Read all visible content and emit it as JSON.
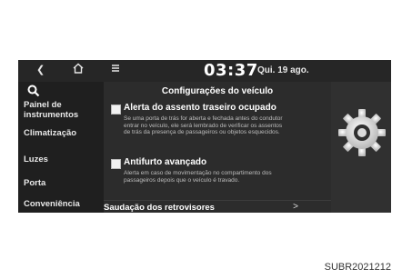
{
  "topbar": {
    "back_icon": "back-arrow-icon",
    "home_icon": "home-icon",
    "menu_icon": "menu-icon",
    "time": "03:37",
    "date": "Qui. 19 ago."
  },
  "sidebar": {
    "search_icon": "search-icon",
    "items": [
      {
        "label": "Painel de instrumentos"
      },
      {
        "label": "Climatização"
      },
      {
        "label": "Luzes"
      },
      {
        "label": "Porta"
      },
      {
        "label": "Conveniência"
      }
    ]
  },
  "panel": {
    "title": "Configurações do veículo",
    "options": [
      {
        "label": "Alerta do assento traseiro ocupado",
        "description": "Se uma porta de trás for aberta e fechada antes do condutor entrar no veículo, ele será lembrado de verificar os assentos de trás da presença de passageiros ou objetos esquecidos.",
        "checked": false
      },
      {
        "label": "Antifurto avançado",
        "description": "Alerta em caso de movimentação no compartimento dos passageiros depois que o veículo é travado.",
        "checked": false
      }
    ],
    "last_row": {
      "label": "Saudação dos retrovisores",
      "arrow": ">"
    }
  },
  "right": {
    "icon": "settings-gear-icon"
  },
  "caption": "SUBR2021212"
}
